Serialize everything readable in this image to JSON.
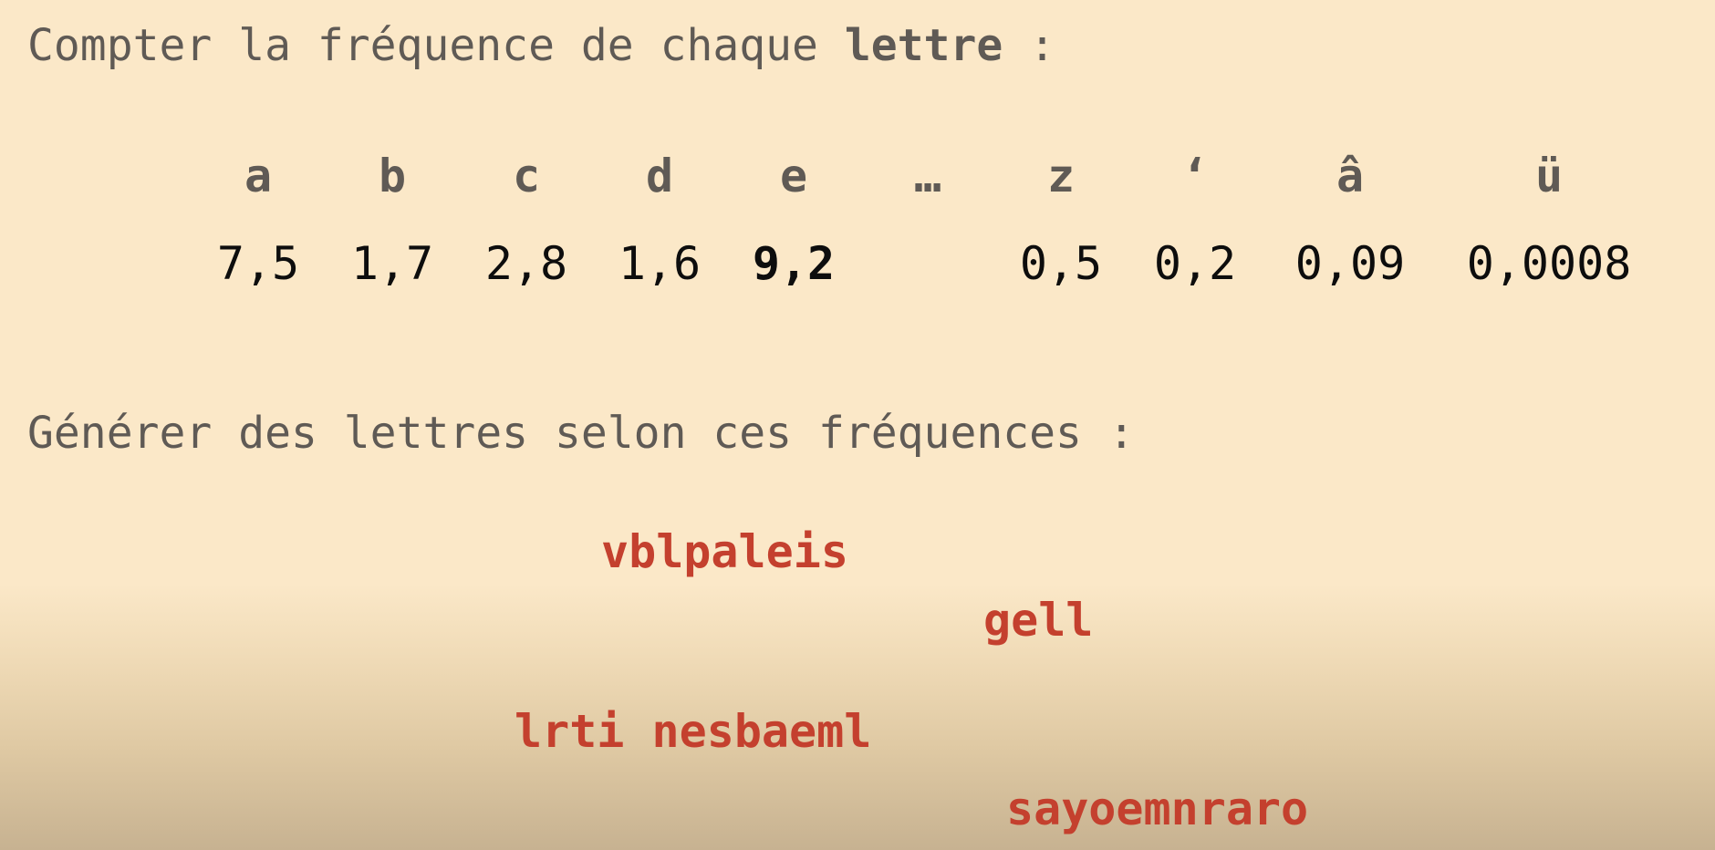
{
  "section1": {
    "heading_prefix": "Compter la fréquence de chaque ",
    "heading_bold": "lettre",
    "heading_suffix": " :"
  },
  "frequency_table": {
    "letters": [
      "a",
      "b",
      "c",
      "d",
      "e",
      "…",
      "z",
      "ʻ",
      "â",
      "ü"
    ],
    "values": [
      "7,5",
      "1,7",
      "2,8",
      "1,6",
      "9,2",
      "",
      "0,5",
      "0,2",
      "0,09",
      "0,0008"
    ],
    "highlighted_letter": "e"
  },
  "section2": {
    "heading": "Générer des lettres selon ces fréquences :"
  },
  "generated_words": [
    "vblpaleis",
    "gell",
    "lrti nesbaeml",
    "sayoemnraro"
  ],
  "colors": {
    "background": "#fbe8c8",
    "heading_text": "#5f5a55",
    "value_text": "#0d0d0d",
    "generated_text": "#c4402e"
  }
}
